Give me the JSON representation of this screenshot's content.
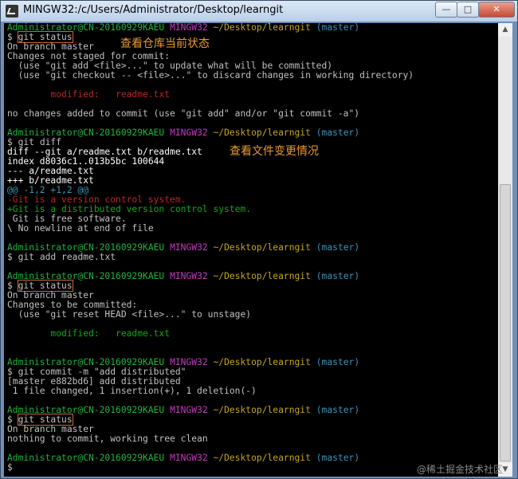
{
  "window": {
    "title": "MINGW32:/c/Users/Administrator/Desktop/learngit",
    "min_label": "—",
    "max_label": "□",
    "close_label": "✕"
  },
  "prompt": {
    "user": "Administrator@CN-20160929KAEU",
    "env": "MINGW32",
    "path": "~/Desktop/learngit",
    "branch": "(master)",
    "symbol": "$"
  },
  "commands": {
    "c1": "git status",
    "c2": "git diff",
    "c3": "git add readme.txt",
    "c4": "git status",
    "c5": "git commit -m \"add distributed\"",
    "c6": "git status"
  },
  "output": {
    "o1": "On branch master",
    "o2": "Changes not staged for commit:",
    "o3": "  (use \"git add <file>...\" to update what will be committed)",
    "o4": "  (use \"git checkout -- <file>...\" to discard changes in working directory)",
    "o5": "        modified:   readme.txt",
    "o6": "no changes added to commit (use \"git add\" and/or \"git commit -a\")",
    "d1": "diff --git a/readme.txt b/readme.txt",
    "d2": "index d8036c1..013b5bc 100644",
    "d3": "--- a/readme.txt",
    "d4": "+++ b/readme.txt",
    "d5": "@@ -1,2 +1,2 @@",
    "d6": "-Git is a version control system.",
    "d7": "+Git is a distributed version control system.",
    "d8": " Git is free software.",
    "d9": "\\ No newline at end of file",
    "s1": "On branch master",
    "s2": "Changes to be committed:",
    "s3": "  (use \"git reset HEAD <file>...\" to unstage)",
    "s4": "        modified:   readme.txt",
    "m1": "[master e882bd6] add distributed",
    "m2": " 1 file changed, 1 insertion(+), 1 deletion(-)",
    "t1": "On branch master",
    "t2": "nothing to commit, working tree clean"
  },
  "annotations": {
    "a1": "查看仓库当前状态",
    "a2": "查看文件变更情况"
  },
  "watermark": "@稀土掘金技术社区",
  "colors": {
    "prompt_user": "#1fb33f",
    "prompt_env": "#c239c2",
    "prompt_path": "#c3a61b",
    "prompt_branch": "#3d94b8",
    "diff_removed": "#bf2424",
    "diff_added": "#16a516",
    "annotation": "#e89a2d"
  }
}
